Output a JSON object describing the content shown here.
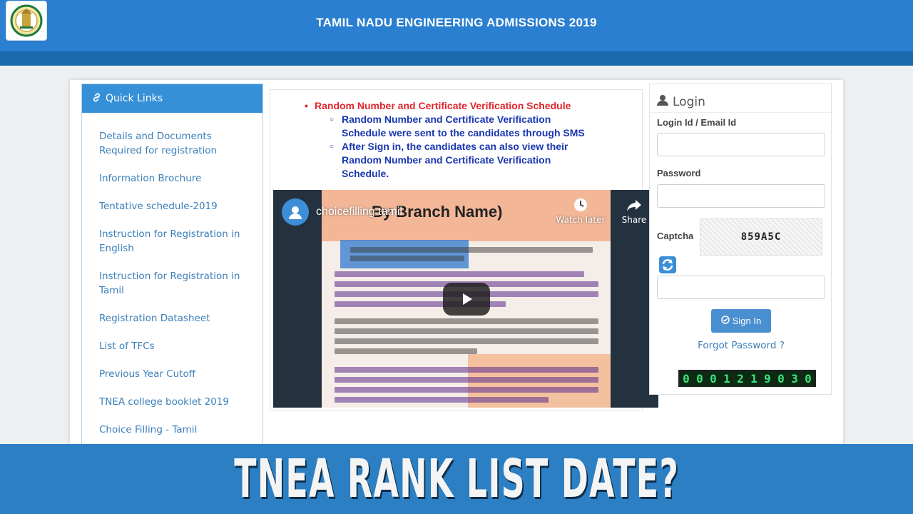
{
  "header": {
    "title": "TAMIL NADU ENGINEERING ADMISSIONS 2019",
    "logo_icon": "tamil-nadu-emblem-icon"
  },
  "quick_links": {
    "title": "Quick Links",
    "icon": "link-icon",
    "items": [
      "Details and Documents Required for registration",
      "Information Brochure",
      "Tentative schedule-2019",
      "Instruction for Registration in English",
      "Instruction for Registration in Tamil",
      "Registration Datasheet",
      "List of TFCs",
      "Previous Year Cutoff",
      "TNEA college booklet 2019",
      "Choice Filling - Tamil"
    ]
  },
  "notice": {
    "heading": "Random Number and Certificate Verification Schedule",
    "points": [
      "Random Number and Certificate Verification Schedule were sent to the candidates through SMS",
      "After Sign in, the candidates can also view their Random Number and Certificate Verification Schedule."
    ],
    "heading_color": "#e0262f",
    "point_color": "#1a37b0"
  },
  "video": {
    "channel_title": "choicefilling tamil",
    "frame_heading": "By Branch Name)",
    "watch_later": "Watch later",
    "share": "Share",
    "icons": [
      "avatar-icon",
      "clock-icon",
      "share-icon",
      "play-icon"
    ]
  },
  "login": {
    "title": "Login",
    "icon": "user-icon",
    "login_id_label": "Login Id / Email Id",
    "password_label": "Password",
    "captcha_label": "Captcha",
    "captcha_text": "859A5C",
    "signin_label": "Sign In",
    "forgot_label": "Forgot Password ?",
    "visitor_counter": [
      "0",
      "0",
      "0",
      "1",
      "2",
      "1",
      "9",
      "0",
      "3",
      "0"
    ]
  },
  "banner": {
    "text": "TNEA RANK LIST DATE?"
  },
  "colors": {
    "header_blue": "#2a7fd0",
    "quick_links_head": "#3590d8",
    "link_blue": "#3b7fb9",
    "banner_blue": "#2c7fc2"
  }
}
